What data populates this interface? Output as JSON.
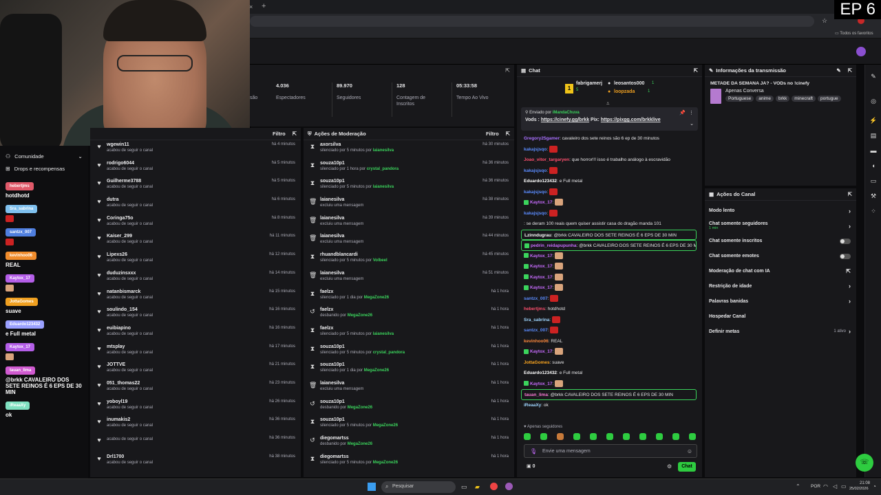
{
  "overlay": {
    "episode": "EP 6"
  },
  "browser": {
    "bookmarks_label": "Todos os favoritos"
  },
  "stats": [
    {
      "value": "4.036",
      "label": "Espectadores"
    },
    {
      "value": "89.970",
      "label": "Seguidores"
    },
    {
      "value": "128",
      "label": "Contagem de Inscritos"
    },
    {
      "value": "05:33:58",
      "label": "Tempo Ao Vivo"
    }
  ],
  "stats_partial": "são",
  "followers_panel": {
    "filter_label": "Filtro",
    "items": [
      {
        "name": "wgewin11",
        "sub": "acabou de seguir o canal",
        "time": "há 4 minutos"
      },
      {
        "name": "rodrigo6044",
        "sub": "acabou de seguir o canal",
        "time": "há 5 minutos"
      },
      {
        "name": "Guilherme3788",
        "sub": "acabou de seguir o canal",
        "time": "há 5 minutos"
      },
      {
        "name": "dutra",
        "sub": "acabou de seguir o canal",
        "time": "há 6 minutos"
      },
      {
        "name": "Coringa75o",
        "sub": "acabou de seguir o canal",
        "time": "há 8 minutos"
      },
      {
        "name": "Kaiser_299",
        "sub": "acabou de seguir o canal",
        "time": "há 11 minutos"
      },
      {
        "name": "Lipexs26",
        "sub": "acabou de seguir o canal",
        "time": "há 12 minutos"
      },
      {
        "name": "duduzinsxxx",
        "sub": "acabou de seguir o canal",
        "time": "há 14 minutos"
      },
      {
        "name": "natanbismarck",
        "sub": "acabou de seguir o canal",
        "time": "há 15 minutos"
      },
      {
        "name": "soulindo_154",
        "sub": "acabou de seguir o canal",
        "time": "há 16 minutos"
      },
      {
        "name": "euibiapino",
        "sub": "acabou de seguir o canal",
        "time": "há 16 minutos"
      },
      {
        "name": "mtsplay",
        "sub": "acabou de seguir o canal",
        "time": "há 17 minutos"
      },
      {
        "name": "JOTTVE",
        "sub": "acabou de seguir o canal",
        "time": "há 21 minutos"
      },
      {
        "name": "051_thomas22",
        "sub": "acabou de seguir o canal",
        "time": "há 23 minutos"
      },
      {
        "name": "yoboyl19",
        "sub": "acabou de seguir o canal",
        "time": "há 26 minutos"
      },
      {
        "name": "inumakis2",
        "sub": "acabou de seguir o canal",
        "time": "há 36 minutos"
      },
      {
        "name": "",
        "sub": "acabou de seguir o canal",
        "time": "há 36 minutos"
      },
      {
        "name": "Drl1700",
        "sub": "acabou de seguir o canal",
        "time": "há 38 minutos"
      }
    ]
  },
  "moderation_panel": {
    "title": "Ações de Moderação",
    "filter_label": "Filtro",
    "items": [
      {
        "icon": "hourglass",
        "name": "axorsilva",
        "sub": "silenciado por 5 minutos por ",
        "by": "laianesilva",
        "time": "há 30 minutos"
      },
      {
        "icon": "hourglass",
        "name": "souza10p1",
        "sub": "silenciado por 1 hora por ",
        "by": "crystal_pandora",
        "time": "há 36 minutos"
      },
      {
        "icon": "hourglass",
        "name": "souza10p1",
        "sub": "silenciado por 5 minutos por ",
        "by": "laianesilva",
        "time": "há 36 minutos"
      },
      {
        "icon": "trash",
        "name": "laianesilva",
        "sub": "excluiu uma mensagem",
        "by": "",
        "time": "há 38 minutos"
      },
      {
        "icon": "trash",
        "name": "laianesilva",
        "sub": "excluiu uma mensagem",
        "by": "",
        "time": "há 39 minutos"
      },
      {
        "icon": "trash",
        "name": "laianesilva",
        "sub": "excluiu uma mensagem",
        "by": "",
        "time": "há 44 minutos"
      },
      {
        "icon": "hourglass",
        "name": "rhuandblancardi",
        "sub": "silenciado por 5 minutos por ",
        "by": "Volbeel",
        "time": "há 45 minutos"
      },
      {
        "icon": "trash",
        "name": "laianesilva",
        "sub": "excluiu uma mensagem",
        "by": "",
        "time": "há 51 minutos"
      },
      {
        "icon": "hourglass",
        "name": "faelzx",
        "sub": "silenciado por 1 dia por ",
        "by": "MegaZone26",
        "time": "há 1 hora"
      },
      {
        "icon": "undo",
        "name": "faelzx",
        "sub": "desbanido por ",
        "by": "MegaZone26",
        "time": "há 1 hora"
      },
      {
        "icon": "hourglass",
        "name": "faelzx",
        "sub": "silenciado por 5 minutos por ",
        "by": "laianesilva",
        "time": "há 1 hora"
      },
      {
        "icon": "hourglass",
        "name": "souza10p1",
        "sub": "silenciado por 5 minutos por ",
        "by": "crystal_pandora",
        "time": "há 1 hora"
      },
      {
        "icon": "hourglass",
        "name": "souza10p1",
        "sub": "silenciado por 1 dia por ",
        "by": "MegaZone26",
        "time": "há 1 hora"
      },
      {
        "icon": "trash",
        "name": "laianesilva",
        "sub": "excluiu uma mensagem",
        "by": "",
        "time": "há 1 hora"
      },
      {
        "icon": "undo",
        "name": "souza10p1",
        "sub": "desbanido por ",
        "by": "MegaZone26",
        "time": "há 1 hora"
      },
      {
        "icon": "hourglass",
        "name": "souza10p1",
        "sub": "silenciado por 5 minutos por ",
        "by": "MegaZone26",
        "time": "há 1 hora"
      },
      {
        "icon": "undo",
        "name": "diegomartss",
        "sub": "desbanido por ",
        "by": "MegaZone26",
        "time": "há 1 hora"
      },
      {
        "icon": "hourglass",
        "name": "diegomartss",
        "sub": "silenciado por 5 minutos por ",
        "by": "MegaZone26",
        "time": "há 1 hora"
      }
    ]
  },
  "chat": {
    "title": "Chat",
    "top_gifters": [
      {
        "rank": "1",
        "name": "fabrigamerj",
        "count": "5"
      },
      {
        "rank": "",
        "name": "leosantos000",
        "count": "1"
      },
      {
        "rank": "",
        "name": "loopzada",
        "count": "1"
      }
    ],
    "pinned": {
      "sent_by_label": "Enviado por",
      "sent_by": "iMandaChuva",
      "text_prefix": "Vods : ",
      "link1": "https://cinefy.gg/brkk",
      "middle": " Pix: ",
      "link2": "https://pixgg.com/brkklive"
    },
    "messages": [
      {
        "user": "Gregory25gamer",
        "color": "#a970ff",
        "text": "cavaleiro dos sete reinos são 6 ep de 30 minutos",
        "emote": "",
        "badge": false,
        "hl": false
      },
      {
        "user": "kakajsjsqo",
        "color": "#5b8cff",
        "text": "",
        "emote": "red",
        "badge": false,
        "hl": false
      },
      {
        "user": "Joao_vitor_targaryen",
        "color": "#ff4f6e",
        "text": "que horror!!! isso é trabalho análogo à escravidão",
        "emote": "",
        "badge": false,
        "hl": false
      },
      {
        "user": "kakajsjsqo",
        "color": "#5b8cff",
        "text": "",
        "emote": "red",
        "badge": false,
        "hl": false
      },
      {
        "user": "Eduardo123432",
        "color": "#ffffff",
        "text": "e Full metal",
        "emote": "",
        "badge": false,
        "hl": false
      },
      {
        "user": "kakajsjsqo",
        "color": "#5b8cff",
        "text": "",
        "emote": "red",
        "badge": false,
        "hl": false
      },
      {
        "user": "Kaytox_17",
        "color": "#c86cff",
        "text": "",
        "emote": "face",
        "badge": true,
        "hl": false
      },
      {
        "user": "kakajsjsqo",
        "color": "#5b8cff",
        "text": "",
        "emote": "red",
        "badge": false,
        "hl": false
      },
      {
        "user": "",
        "color": "#ff3030",
        "text": "se deram 100 reais quem quiser assistir casa do dragão manda 101",
        "emote": "",
        "badge": false,
        "hl": false
      },
      {
        "user": "Lzinndugrau",
        "color": "#ffffff",
        "text": "@brkk CAVALEIRO DOS SETE REINOS É 6 EPS DE 30 MIN",
        "emote": "",
        "badge": false,
        "hl": true
      },
      {
        "user": "pedrin_reidapupunha",
        "color": "#c86cff",
        "text": "@brkk CAVALEIRO DOS SETE REINOS É 6 EPS DE 30 MIN",
        "emote": "",
        "badge": true,
        "hl": true
      },
      {
        "user": "Kaytox_17",
        "color": "#c86cff",
        "text": "",
        "emote": "face",
        "badge": true,
        "hl": false
      },
      {
        "user": "Kaytox_17",
        "color": "#c86cff",
        "text": "",
        "emote": "face",
        "badge": true,
        "hl": false
      },
      {
        "user": "Kaytox_17",
        "color": "#c86cff",
        "text": "",
        "emote": "face",
        "badge": true,
        "hl": false
      },
      {
        "user": "Kaytox_17",
        "color": "#c86cff",
        "text": "",
        "emote": "face",
        "badge": true,
        "hl": false
      },
      {
        "user": "santzx_007",
        "color": "#5b8cff",
        "text": "",
        "emote": "red",
        "badge": false,
        "hl": false
      },
      {
        "user": "hebertjms",
        "color": "#ff4f6e",
        "text": "hotdhotd",
        "emote": "",
        "badge": false,
        "hl": false
      },
      {
        "user": "Sra_sabrina",
        "color": "#9fd6ff",
        "text": "",
        "emote": "red",
        "badge": false,
        "hl": false
      },
      {
        "user": "santzx_007",
        "color": "#5b8cff",
        "text": "",
        "emote": "red",
        "badge": false,
        "hl": false
      },
      {
        "user": "kevinhoo06",
        "color": "#ff8a3d",
        "text": "REAL",
        "emote": "",
        "badge": false,
        "hl": false
      },
      {
        "user": "Kaytox_17",
        "color": "#c86cff",
        "text": "",
        "emote": "face",
        "badge": true,
        "hl": false
      },
      {
        "user": "JottaGomes",
        "color": "#ffa81f",
        "text": "suave",
        "emote": "",
        "badge": false,
        "hl": false
      },
      {
        "user": "Eduardo123432",
        "color": "#ffffff",
        "text": "e Full metal",
        "emote": "",
        "badge": false,
        "hl": false
      },
      {
        "user": "Kaytox_17",
        "color": "#c86cff",
        "text": "",
        "emote": "face",
        "badge": true,
        "hl": false
      },
      {
        "user": "tauan_lima",
        "color": "#ff7bd8",
        "text": "@brkk CAVALEIRO DOS SETE REINOS É 6 EPS DE 30 MIN",
        "emote": "",
        "badge": false,
        "hl": true
      },
      {
        "user": "iReaaXy",
        "color": "#9fd6ff",
        "text": "ok",
        "emote": "",
        "badge": false,
        "hl": false
      }
    ],
    "followers_only_label": "Apenas seguidores",
    "input_placeholder": "Envie uma mensagem",
    "points": "0",
    "send_label": "Chat"
  },
  "stream_info": {
    "title": "Informações da transmissão",
    "stream_title": "METADE DA SEMANA JA? - VODs no !cinefy",
    "category": "Apenas Conversa",
    "tags": [
      "Portuguese",
      "anime",
      "brkk",
      "minecraft",
      "portugue"
    ]
  },
  "channel_actions": {
    "title": "Ações do Canal",
    "items": [
      {
        "label": "Modo lento",
        "sub": "",
        "right": "",
        "control": "chevron"
      },
      {
        "label": "Chat somente seguidores",
        "sub": "1 min",
        "right": "",
        "control": "chevron"
      },
      {
        "label": "Chat somente inscritos",
        "sub": "",
        "right": "",
        "control": "toggle"
      },
      {
        "label": "Chat somente emotes",
        "sub": "",
        "right": "",
        "control": "toggle"
      },
      {
        "label": "Moderação de chat com IA",
        "sub": "",
        "right": "",
        "control": "external"
      },
      {
        "label": "Restrição de idade",
        "sub": "",
        "right": "",
        "control": "chevron"
      },
      {
        "label": "Palavras banidas",
        "sub": "",
        "right": "",
        "control": "chevron"
      },
      {
        "label": "Hospedar Canal",
        "sub": "",
        "right": "",
        "control": "none"
      },
      {
        "label": "Definir metas",
        "sub": "",
        "right": "1 ativo",
        "control": "chevron"
      }
    ]
  },
  "community": {
    "title": "Comunidade",
    "drops_label": "Drops e recompensas"
  },
  "overlay_chat": [
    {
      "user": "hebertjms",
      "color": "#e05a6a",
      "text": "hotdhotd",
      "emote": ""
    },
    {
      "user": "Sra_sabrina",
      "color": "#7fc0ee",
      "text": "",
      "emote": "red"
    },
    {
      "user": "santzx_007",
      "color": "#4f7fe0",
      "text": "",
      "emote": "red"
    },
    {
      "user": "kevinhoo06",
      "color": "#f08c2c",
      "text": "REAL",
      "emote": ""
    },
    {
      "user": "Kaytox_17",
      "color": "#b45ee8",
      "text": "",
      "emote": "face"
    },
    {
      "user": "JottaGomes",
      "color": "#f0a020",
      "text": "suave",
      "emote": ""
    },
    {
      "user": "Eduardo123432",
      "color": "#9aa0ff",
      "text": "e Full metal",
      "emote": ""
    },
    {
      "user": "Kaytox_17",
      "color": "#b45ee8",
      "text": "",
      "emote": "face"
    },
    {
      "user": "tauan_lima",
      "color": "#d05ad0",
      "text": "@brkk CAVALEIRO DOS SETE REINOS É 6 EPS DE 30 MIN",
      "emote": ""
    },
    {
      "user": "iReaaXy",
      "color": "#7fe0c0",
      "text": "ok",
      "emote": ""
    }
  ],
  "taskbar": {
    "search_placeholder": "Pesquisar",
    "lang": "POR",
    "time": "21:08",
    "date": "25/02/2026"
  }
}
